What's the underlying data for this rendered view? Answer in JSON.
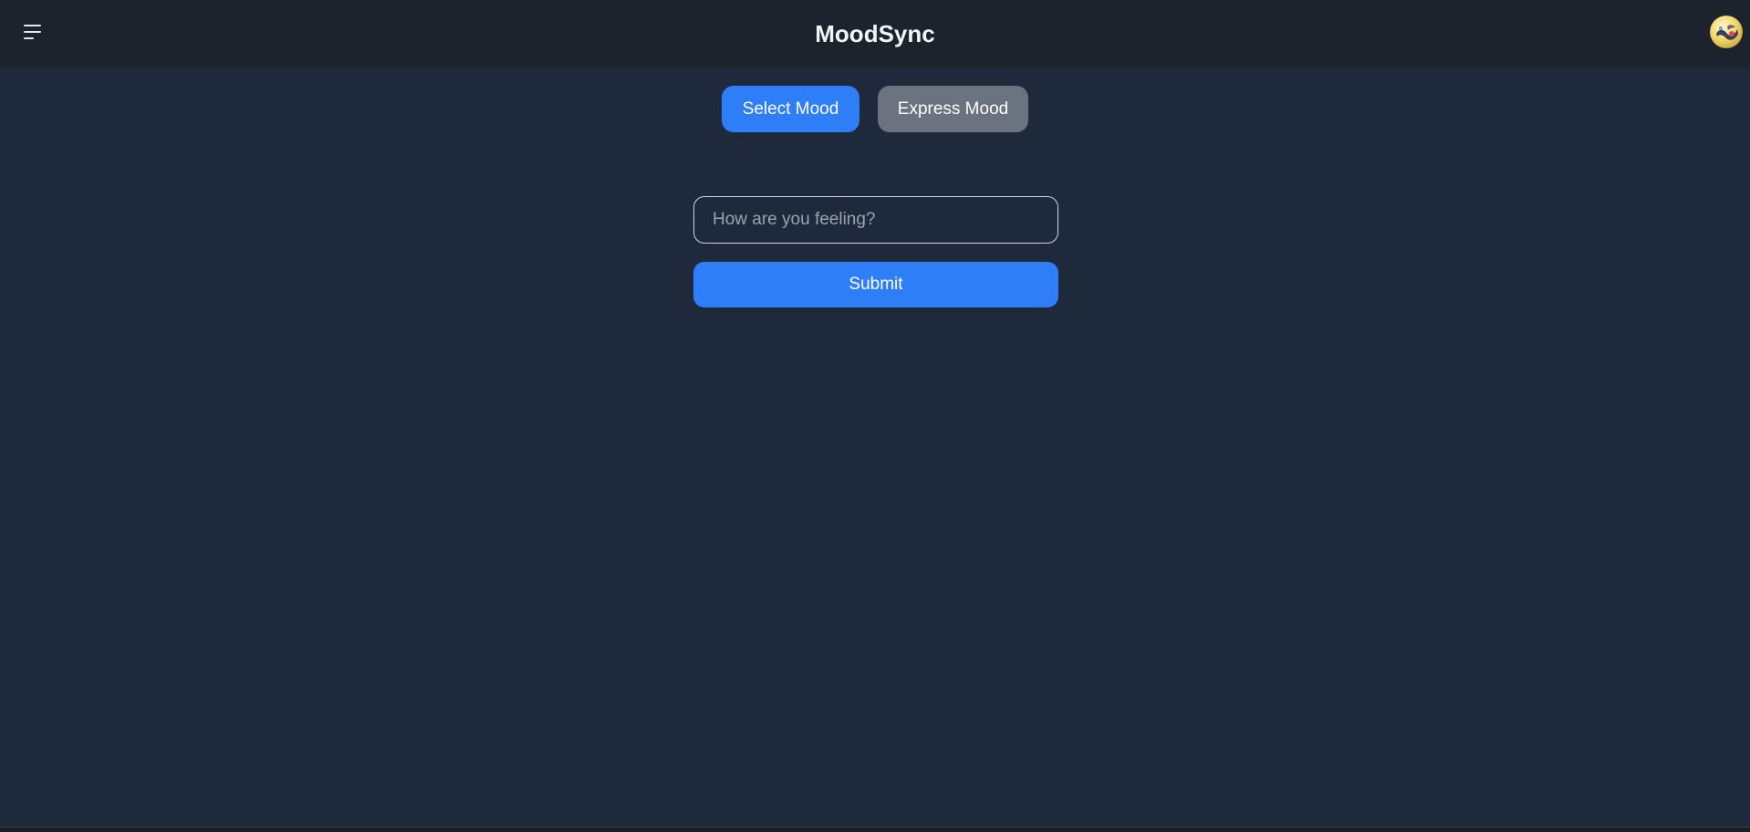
{
  "header": {
    "title": "MoodSync",
    "menu_icon": "hamburger-menu-icon",
    "avatar_icon": "user-avatar"
  },
  "mode_tabs": {
    "select_label": "Select Mood",
    "express_label": "Express Mood",
    "active": "Select Mood"
  },
  "form": {
    "mood_placeholder": "How are you feeling?",
    "mood_value": "",
    "submit_label": "Submit"
  },
  "colors": {
    "background": "#1e293b",
    "header": "#1d232c",
    "primary": "#2d7ef7",
    "secondary": "#6b7280"
  }
}
